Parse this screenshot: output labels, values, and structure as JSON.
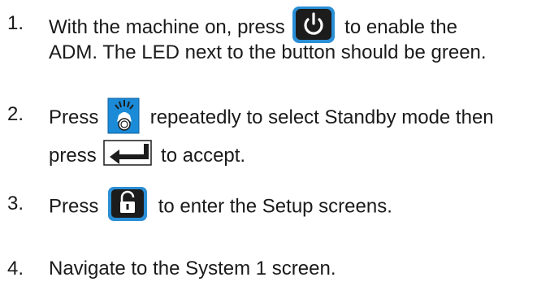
{
  "steps": [
    {
      "number": "1.",
      "line1_before": "With the machine on, press",
      "line1_after": "to enable the",
      "line2": "ADM. The LED next to the button should be green.",
      "icon": "power-button-icon"
    },
    {
      "number": "2.",
      "line1_before": "Press",
      "line1_after": "repeatedly to select Standby mode then",
      "line2_before": "press",
      "line2_after": "to accept.",
      "icons": [
        "mode-button-icon",
        "enter-button-icon"
      ]
    },
    {
      "number": "3.",
      "line1_before": "Press",
      "line1_after": "to enter the Setup screens.",
      "icon": "lock-button-icon"
    },
    {
      "number": "4.",
      "line1": "Navigate to the System 1 screen."
    }
  ],
  "colors": {
    "text": "#1a1a1a",
    "button_dark": "#1c1c1c",
    "button_blue": "#2a8fd6",
    "mode_blue": "#1b8bd8",
    "enter_green_border": "#1a1a1a"
  }
}
